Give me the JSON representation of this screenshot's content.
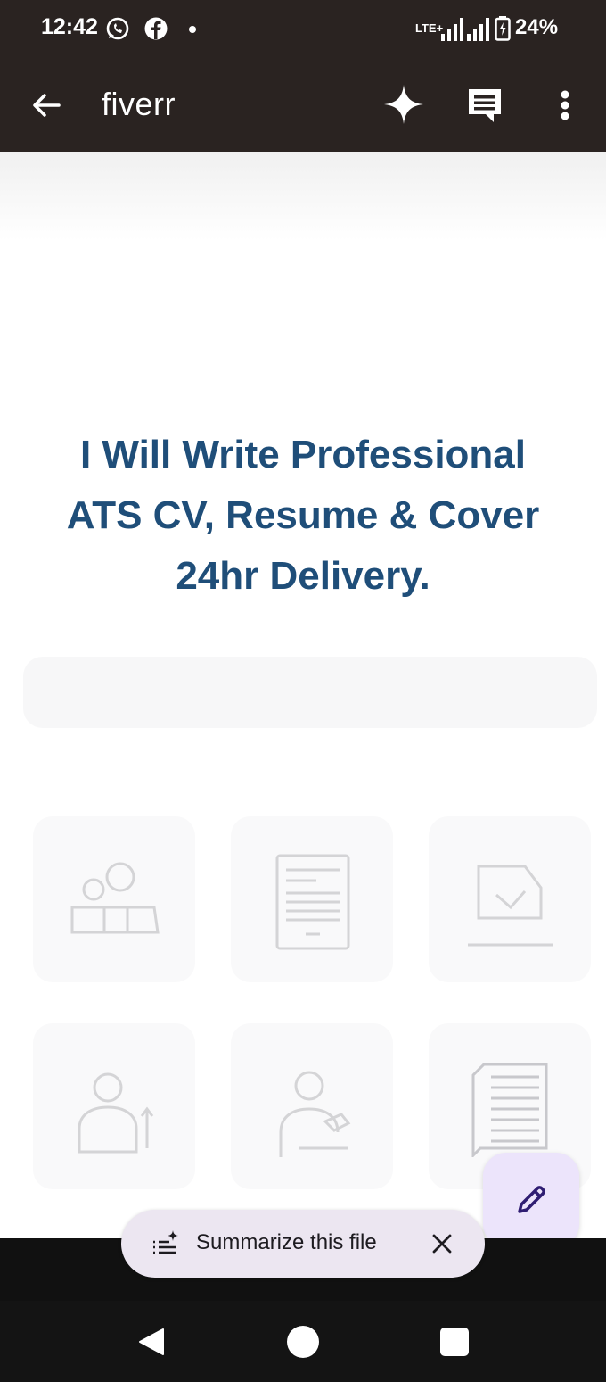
{
  "status_bar": {
    "time": "12:42",
    "network": "LTE+",
    "battery": "24%",
    "icons": [
      "whatsapp-icon",
      "facebook-icon",
      "notification-dot-icon",
      "signal-icon",
      "battery-icon"
    ]
  },
  "app_bar": {
    "title": "fiverr",
    "icons": [
      "back-arrow-icon",
      "sparkle-icon",
      "comment-icon",
      "more-vert-icon"
    ]
  },
  "document": {
    "headline_lines": [
      "I Will Write Professional",
      "ATS CV, Resume & Cover",
      "24hr Delivery."
    ],
    "headline_color": "#1f4e79"
  },
  "summarize_chip": {
    "label": "Summarize this file"
  },
  "colors": {
    "top_bar": "#2a2321",
    "chip_bg": "#ece6f1",
    "fab_bg": "#ece4fb",
    "fab_icon": "#2f1d72"
  }
}
